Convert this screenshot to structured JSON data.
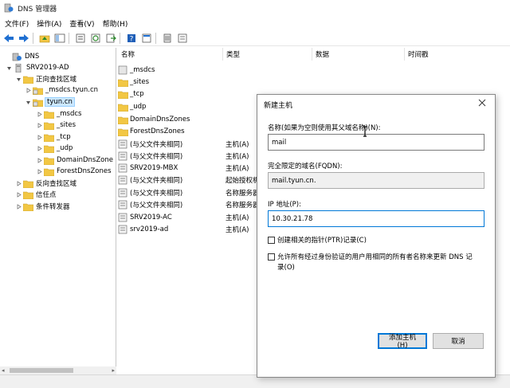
{
  "window": {
    "title": "DNS 管理器"
  },
  "menu": [
    "文件(F)",
    "操作(A)",
    "查看(V)",
    "帮助(H)"
  ],
  "toolbar": {
    "icons": [
      "back-arrow-icon",
      "forward-arrow-icon",
      "folder-up-icon",
      "show-tree-icon",
      "properties-icon",
      "refresh-icon",
      "export-icon",
      "help-icon",
      "console-icon",
      "record-icon",
      "domain-icon"
    ]
  },
  "tree": {
    "items": [
      {
        "label": "DNS",
        "icon": "dns-icon"
      },
      {
        "label": "SRV2019-AD",
        "icon": "server-icon"
      },
      {
        "label": "正向查找区域",
        "icon": "folder-icon"
      },
      {
        "label": "_msdcs.tyun.cn",
        "icon": "zone-icon"
      },
      {
        "label": "tyun.cn",
        "icon": "zone-icon"
      },
      {
        "label": "_msdcs",
        "icon": "folder-icon"
      },
      {
        "label": "_sites",
        "icon": "folder-icon"
      },
      {
        "label": "_tcp",
        "icon": "folder-icon"
      },
      {
        "label": "_udp",
        "icon": "folder-icon"
      },
      {
        "label": "DomainDnsZone",
        "icon": "folder-icon"
      },
      {
        "label": "ForestDnsZones",
        "icon": "folder-icon"
      },
      {
        "label": "反向查找区域",
        "icon": "folder-icon"
      },
      {
        "label": "信任点",
        "icon": "folder-icon"
      },
      {
        "label": "条件转发器",
        "icon": "folder-icon"
      }
    ]
  },
  "list": {
    "columns": [
      "名称",
      "类型",
      "数据",
      "时间戳"
    ],
    "rows": [
      {
        "name": "_msdcs",
        "type": "",
        "icon": "folder-gray-icon"
      },
      {
        "name": "_sites",
        "type": "",
        "icon": "folder-icon"
      },
      {
        "name": "_tcp",
        "type": "",
        "icon": "folder-icon"
      },
      {
        "name": "_udp",
        "type": "",
        "icon": "folder-icon"
      },
      {
        "name": "DomainDnsZones",
        "type": "",
        "icon": "folder-icon"
      },
      {
        "name": "ForestDnsZones",
        "type": "",
        "icon": "folder-icon"
      },
      {
        "name": "(与父文件夹相同)",
        "type": "主机(A)",
        "icon": "record-icon"
      },
      {
        "name": "(与父文件夹相同)",
        "type": "主机(A)",
        "icon": "record-icon"
      },
      {
        "name": "SRV2019-MBX",
        "type": "主机(A)",
        "icon": "record-icon"
      },
      {
        "name": "(与父文件夹相同)",
        "type": "起始授权机",
        "icon": "record-icon"
      },
      {
        "name": "(与父文件夹相同)",
        "type": "名称服务器",
        "icon": "record-icon"
      },
      {
        "name": "(与父文件夹相同)",
        "type": "名称服务器",
        "icon": "record-icon"
      },
      {
        "name": "SRV2019-AC",
        "type": "主机(A)",
        "icon": "record-icon"
      },
      {
        "name": "srv2019-ad",
        "type": "主机(A)",
        "icon": "record-icon"
      }
    ]
  },
  "dialog": {
    "title": "新建主机",
    "name_label": "名称(如果为空则使用其父域名称)(N):",
    "name_value": "mail",
    "fqdn_label": "完全限定的域名(FQDN):",
    "fqdn_value": "mail.tyun.cn.",
    "ip_label": "IP 地址(P):",
    "ip_value": "10.30.21.78",
    "ptr_label": "创建相关的指针(PTR)记录(C)",
    "allow_label_1": "允许所有经过身份验证的用户用相同的所有者名称来更新 DNS 记",
    "allow_label_2": "录(O)",
    "ok_label": "添加主机(H)",
    "cancel_label": "取消"
  }
}
